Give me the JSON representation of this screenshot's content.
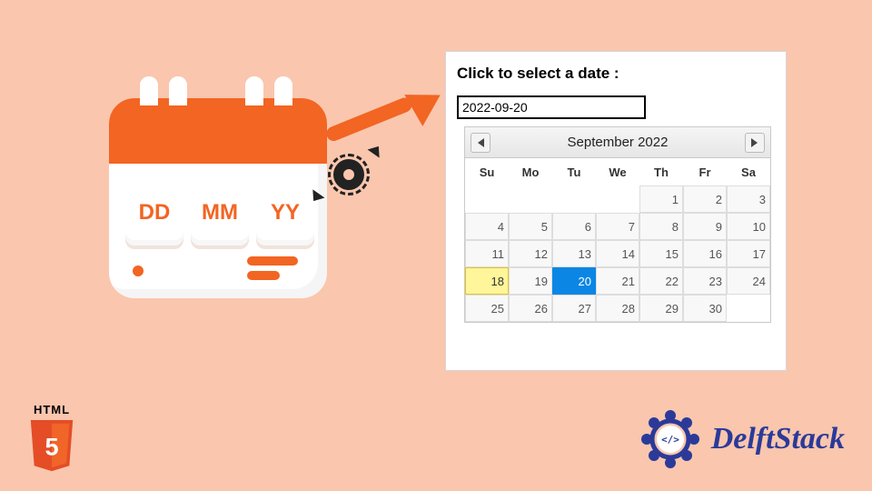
{
  "icon": {
    "cards": [
      "DD",
      "MM",
      "YY"
    ]
  },
  "panel": {
    "title": "Click to select a date :",
    "input_value": "2022-09-20"
  },
  "datepicker": {
    "month_title": "September 2022",
    "dow": [
      "Su",
      "Mo",
      "Tu",
      "We",
      "Th",
      "Fr",
      "Sa"
    ],
    "leading_blanks": 4,
    "days": 30,
    "today": 18,
    "selected": 20,
    "trailing_blanks": 1
  },
  "badges": {
    "html5_label": "HTML",
    "html5_number": "5",
    "delftstack": "DelftStack"
  }
}
